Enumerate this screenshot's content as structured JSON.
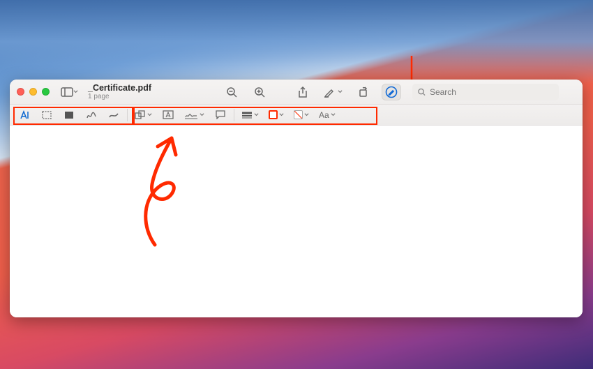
{
  "document": {
    "title": "_Certificate.pdf",
    "page_count_label": "1 page"
  },
  "search": {
    "placeholder": "Search"
  },
  "colors": {
    "annotation": "#ff2a00",
    "markup_active": "#1069d5"
  },
  "markup_toolbar": {
    "text_style_label": "Aa"
  },
  "icons": {
    "sidebar": "sidebar",
    "zoom_out": "zoom-out",
    "zoom_in": "zoom-in",
    "share": "share",
    "highlight": "highlight-pen",
    "rotate": "rotate",
    "markup": "markup-pen-circle",
    "search": "magnifier",
    "text_select": "text-cursor",
    "rect_select": "rectangle-select",
    "redact": "redact-block",
    "sketch": "freehand-sketch",
    "draw": "freehand-draw",
    "shapes": "shapes",
    "textbox": "text-box",
    "sign": "signature",
    "note": "sticky-note",
    "line_style": "line-style",
    "stroke_color": "stroke-color",
    "fill_color": "fill-color",
    "text_style": "text-style"
  }
}
